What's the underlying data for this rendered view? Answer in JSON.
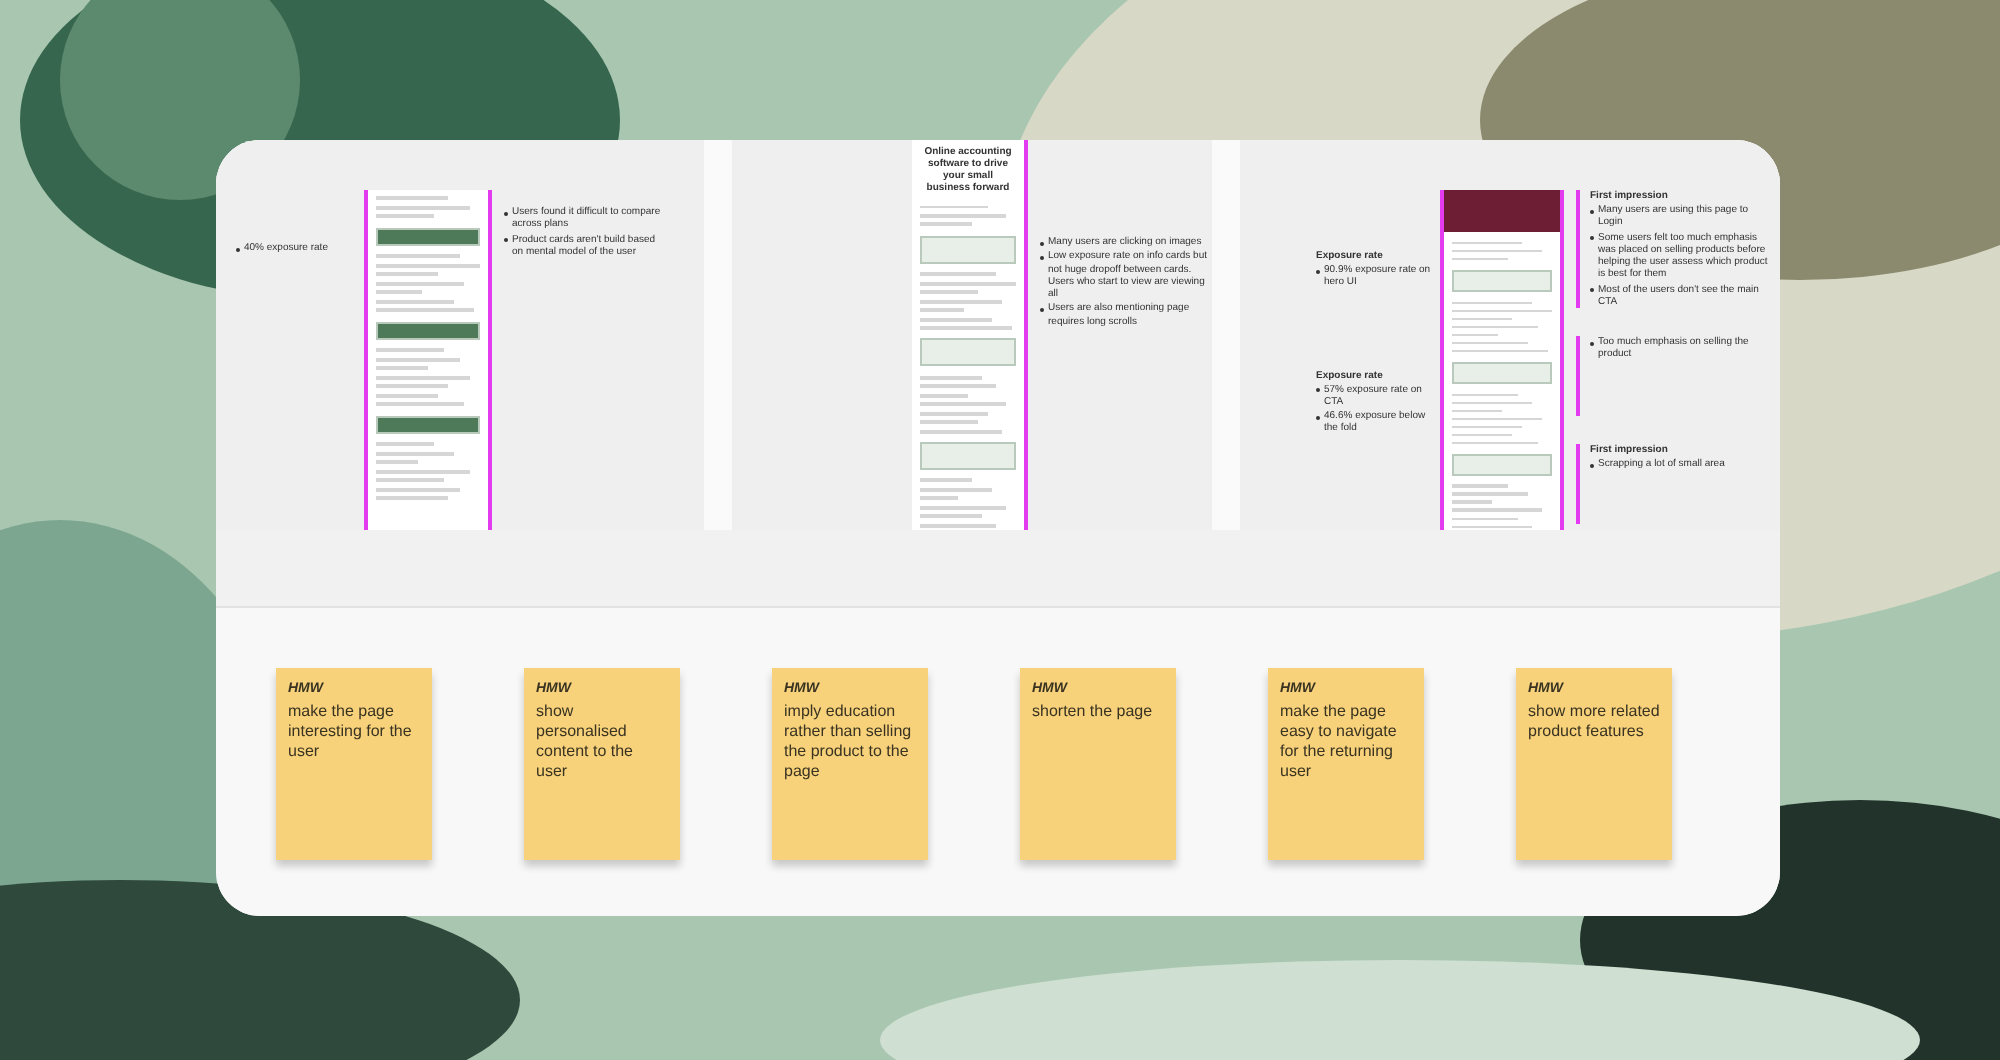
{
  "board": {
    "panels": [
      {
        "left_notes": [
          {
            "bullets": [
              "40% exposure rate"
            ]
          }
        ],
        "right_notes": [
          {
            "bullets": [
              "Users found it difficult to compare across plans",
              "Product cards aren't build based on mental model of the user"
            ]
          }
        ]
      },
      {
        "mockup_heading": "Online accounting software to drive your small business forward",
        "right_notes": [
          {
            "bullets": [
              "Many users are clicking on images",
              "Low exposure rate on info cards but not huge dropoff between cards. Users who start to view are viewing all",
              "Users are also mentioning page requires long scrolls"
            ]
          }
        ]
      },
      {
        "left_notes": [
          {
            "heading": "Exposure rate",
            "bullets": [
              "90.9% exposure rate on hero UI"
            ]
          },
          {
            "heading": "Exposure rate",
            "bullets": [
              "57% exposure rate on CTA",
              "46.6% exposure below the fold"
            ]
          }
        ],
        "right_notes": [
          {
            "heading": "First impression",
            "bullets": [
              "Many users are using this page to Login",
              "Some users felt too much emphasis was placed on selling products before helping the user assess which product is best for them",
              "Most of the users don't see the main CTA"
            ]
          },
          {
            "bullets": [
              "Too much emphasis on selling the product"
            ]
          },
          {
            "heading": "First impression",
            "bullets": [
              "Scrapping a lot of small area"
            ]
          }
        ]
      }
    ]
  },
  "stickies": [
    {
      "tag": "HMW",
      "text": "make the page interesting for the user"
    },
    {
      "tag": "HMW",
      "text": "show personalised content to the user"
    },
    {
      "tag": "HMW",
      "text": "imply education rather than selling the product to the page"
    },
    {
      "tag": "HMW",
      "text": "shorten the page"
    },
    {
      "tag": "HMW",
      "text": "make the page easy to navigate for the returning user"
    },
    {
      "tag": "HMW",
      "text": "show more related product features"
    }
  ]
}
